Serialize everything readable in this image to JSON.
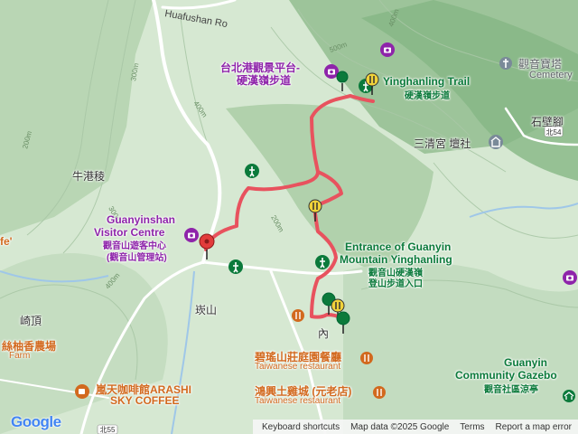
{
  "map": {
    "colors": {
      "trail": "#e8525e",
      "contour": "#a9c7a6",
      "road": "#ffffff",
      "poi_purple": "#8e24aa",
      "poi_green": "#0b7a3b",
      "poi_orange": "#d2691e",
      "marker_red": "#e23b3b",
      "marker_yellow": "#f0d23a"
    },
    "roads": [
      {
        "name": "Huafushan Ro"
      },
      {
        "name": "北55"
      },
      {
        "name": "北54"
      }
    ],
    "contour_labels": [
      "500m",
      "400m",
      "300m",
      "400m",
      "200m",
      "300m",
      "200m",
      "400m"
    ],
    "places": [
      {
        "name": "牛港稜"
      },
      {
        "name": "崎頂"
      },
      {
        "name": "崁山"
      },
      {
        "name": "內"
      },
      {
        "name": "石壁腳"
      },
      {
        "name": "fe'"
      }
    ],
    "pois": [
      {
        "name": "台北港觀景平台-",
        "icon": "camera-icon"
      },
      {
        "name": "硬漢嶺步道",
        "icon": "camera-icon"
      },
      {
        "name": "Yinghanling Trail",
        "icon": "hiking-icon"
      },
      {
        "name": "硬漢嶺步道",
        "icon": "hiking-icon"
      },
      {
        "name": "觀音寶塔",
        "icon": "cemetery-icon"
      },
      {
        "name": "Cemetery",
        "icon": "cemetery-icon"
      },
      {
        "name": "三清宮 壇社",
        "icon": "temple-icon"
      },
      {
        "name": "Guanyinshan",
        "icon": "camera-icon"
      },
      {
        "name": "Visitor Centre",
        "icon": "camera-icon"
      },
      {
        "name": "觀音山遊客中心",
        "icon": "camera-icon"
      },
      {
        "name": "(觀音山管理站)",
        "icon": "camera-icon"
      },
      {
        "name": "Entrance of Guanyin",
        "icon": "hiking-icon"
      },
      {
        "name": "Mountain Yinghanling",
        "icon": "hiking-icon"
      },
      {
        "name": "觀音山硬漢嶺",
        "icon": "hiking-icon"
      },
      {
        "name": "登山步道入口",
        "icon": "hiking-icon"
      },
      {
        "name": "碧瑤山莊庭園餐廳",
        "icon": "restaurant-icon"
      },
      {
        "name": "Taiwanese restaurant",
        "icon": "restaurant-icon"
      },
      {
        "name": "鴻興土雞城 (元老店)",
        "icon": "restaurant-icon"
      },
      {
        "name": "Taiwanese restaurant",
        "icon": "restaurant-icon"
      },
      {
        "name": "嵐天咖啡館ARASHI",
        "icon": "cafe-icon"
      },
      {
        "name": "SKY COFFEE",
        "icon": "cafe-icon"
      },
      {
        "name": "絲柚香農場",
        "icon": "farm-icon"
      },
      {
        "name": "Farm",
        "icon": "farm-icon"
      },
      {
        "name": "Guanyin",
        "icon": "gazebo-icon"
      },
      {
        "name": "Community Gazebo",
        "icon": "gazebo-icon"
      },
      {
        "name": "觀音社區涼亭",
        "icon": "gazebo-icon"
      }
    ],
    "footer": {
      "keyboard": "Keyboard shortcuts",
      "mapdata": "Map data ©2025 Google",
      "terms": "Terms",
      "report": "Report a map error"
    },
    "logo": "Google"
  }
}
